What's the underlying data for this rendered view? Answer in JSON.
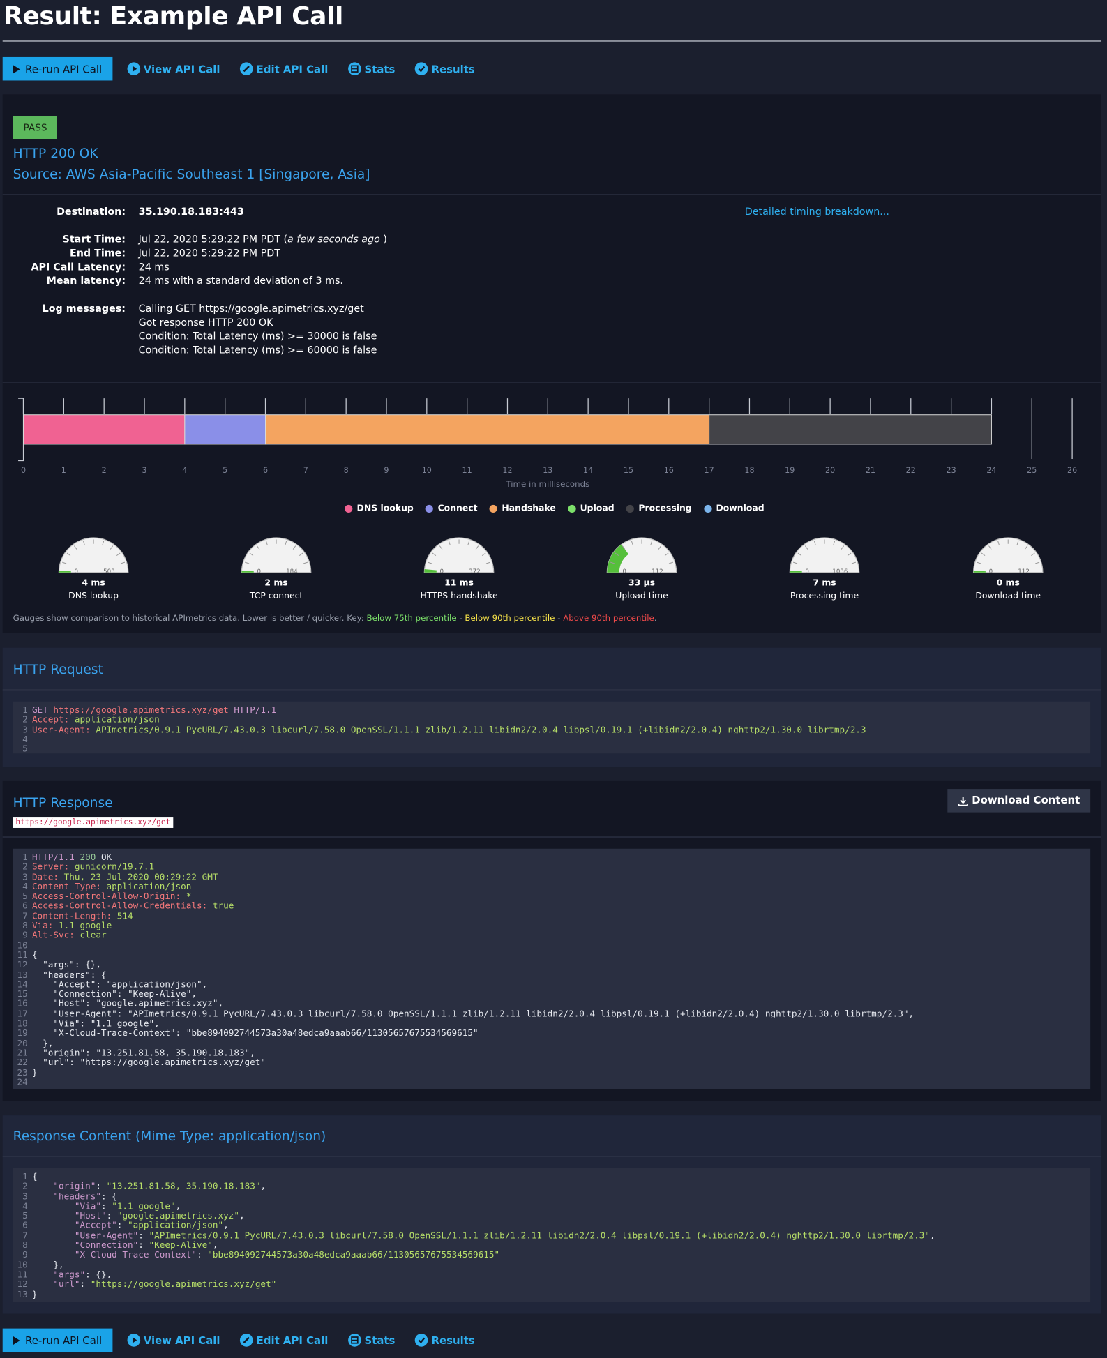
{
  "page": {
    "title": "Result: Example API Call"
  },
  "actions": {
    "rerun": "Re-run API Call",
    "view": "View API Call",
    "edit": "Edit API Call",
    "stats": "Stats",
    "results": "Results"
  },
  "summary": {
    "status": "PASS",
    "http_status": "HTTP 200 OK",
    "source": "Source: AWS Asia-Pacific Southeast 1 [Singapore, Asia]",
    "detail_link": "Detailed timing breakdown...",
    "destination_label": "Destination:",
    "destination": "35.190.18.183:443",
    "start_label": "Start Time:",
    "start_time": "Jul 22, 2020 5:29:22 PM PDT (",
    "start_relative": "a few seconds ago",
    "start_tail": " )",
    "end_label": "End Time:",
    "end_time": "Jul 22, 2020 5:29:22 PM PDT",
    "latency_label": "API Call Latency:",
    "latency": "24 ms",
    "mean_label": "Mean latency:",
    "mean": "24 ms with a standard deviation of 3 ms.",
    "log_label": "Log messages:",
    "log": [
      "Calling GET https://google.apimetrics.xyz/get",
      "Got response HTTP 200 OK",
      "Condition: Total Latency (ms) >= 30000 is false",
      "Condition: Total Latency (ms) >= 60000 is false"
    ]
  },
  "chart_data": {
    "type": "bar",
    "xlabel": "Time in milliseconds",
    "xlim": [
      0,
      26
    ],
    "ticks": [
      "0",
      "1",
      "2",
      "3",
      "4",
      "5",
      "6",
      "7",
      "8",
      "9",
      "10",
      "11",
      "12",
      "13",
      "14",
      "15",
      "16",
      "17",
      "18",
      "19",
      "20",
      "21",
      "22",
      "23",
      "24",
      "25",
      "26"
    ],
    "segments": [
      {
        "name": "DNS lookup",
        "start": 0,
        "end": 4,
        "color": "#f06292"
      },
      {
        "name": "Connect",
        "start": 4,
        "end": 6,
        "color": "#8a8fe8"
      },
      {
        "name": "Handshake",
        "start": 6,
        "end": 17,
        "color": "#f4a460"
      },
      {
        "name": "Upload",
        "start": 17,
        "end": 17,
        "color": "#7ce06a"
      },
      {
        "name": "Processing",
        "start": 17,
        "end": 24,
        "color": "#434348"
      },
      {
        "name": "Download",
        "start": 24,
        "end": 24,
        "color": "#7cb5ec"
      }
    ],
    "legend": [
      "DNS lookup",
      "Connect",
      "Handshake",
      "Upload",
      "Processing",
      "Download"
    ]
  },
  "gauges": [
    {
      "value": "4 ms",
      "label": "DNS lookup",
      "min": "0",
      "max": "503",
      "fraction": 0.008
    },
    {
      "value": "2 ms",
      "label": "TCP connect",
      "min": "0",
      "max": "184",
      "fraction": 0.011
    },
    {
      "value": "11 ms",
      "label": "HTTPS handshake",
      "min": "0",
      "max": "372",
      "fraction": 0.03
    },
    {
      "value": "33 µs",
      "label": "Upload time",
      "min": "0",
      "max": "112",
      "fraction": 0.3
    },
    {
      "value": "7 ms",
      "label": "Processing time",
      "min": "0",
      "max": "1036",
      "fraction": 0.007
    },
    {
      "value": "0 ms",
      "label": "Download time",
      "min": "0",
      "max": "112",
      "fraction": 0
    }
  ],
  "gauge_note": {
    "text": "Gauges show comparison to historical APImetrics data. Lower is better / quicker. Key: ",
    "green": "Below 75th percentile",
    "sep1": " - ",
    "yellow": "Below 90th percentile",
    "sep2": " - ",
    "red": "Above 90th percentile",
    "end": "."
  },
  "request": {
    "title": "HTTP Request"
  },
  "response": {
    "title": "HTTP Response",
    "url": "https://google.apimetrics.xyz/get",
    "download": "Download Content"
  },
  "content": {
    "title": "Response Content (Mime Type: application/json)"
  },
  "colors": {
    "accent": "#1aa3e8",
    "pass": "#5cb85c",
    "below75": "#7ce06a",
    "below90": "#f7e34a",
    "above90": "#f04a4a"
  }
}
